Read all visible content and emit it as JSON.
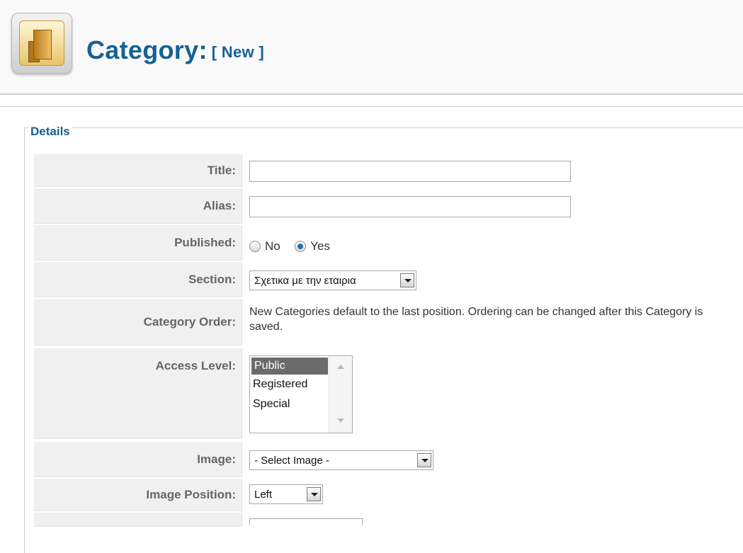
{
  "header": {
    "title": "Category:",
    "state": "[ New ]"
  },
  "details": {
    "legend": "Details",
    "fields": {
      "title": {
        "label": "Title:",
        "value": ""
      },
      "alias": {
        "label": "Alias:",
        "value": ""
      },
      "published": {
        "label": "Published:",
        "options": [
          "No",
          "Yes"
        ],
        "selected": "Yes"
      },
      "section": {
        "label": "Section:",
        "value": "Σχετικα με την εταιρια"
      },
      "category_order": {
        "label": "Category Order:",
        "text": "New Categories default to the last position. Ordering can be changed after this Category is saved."
      },
      "access_level": {
        "label": "Access Level:",
        "options": [
          "Public",
          "Registered",
          "Special"
        ],
        "selected": "Public"
      },
      "image": {
        "label": "Image:",
        "value": "- Select Image -"
      },
      "image_position": {
        "label": "Image Position:",
        "value": "Left"
      }
    }
  }
}
